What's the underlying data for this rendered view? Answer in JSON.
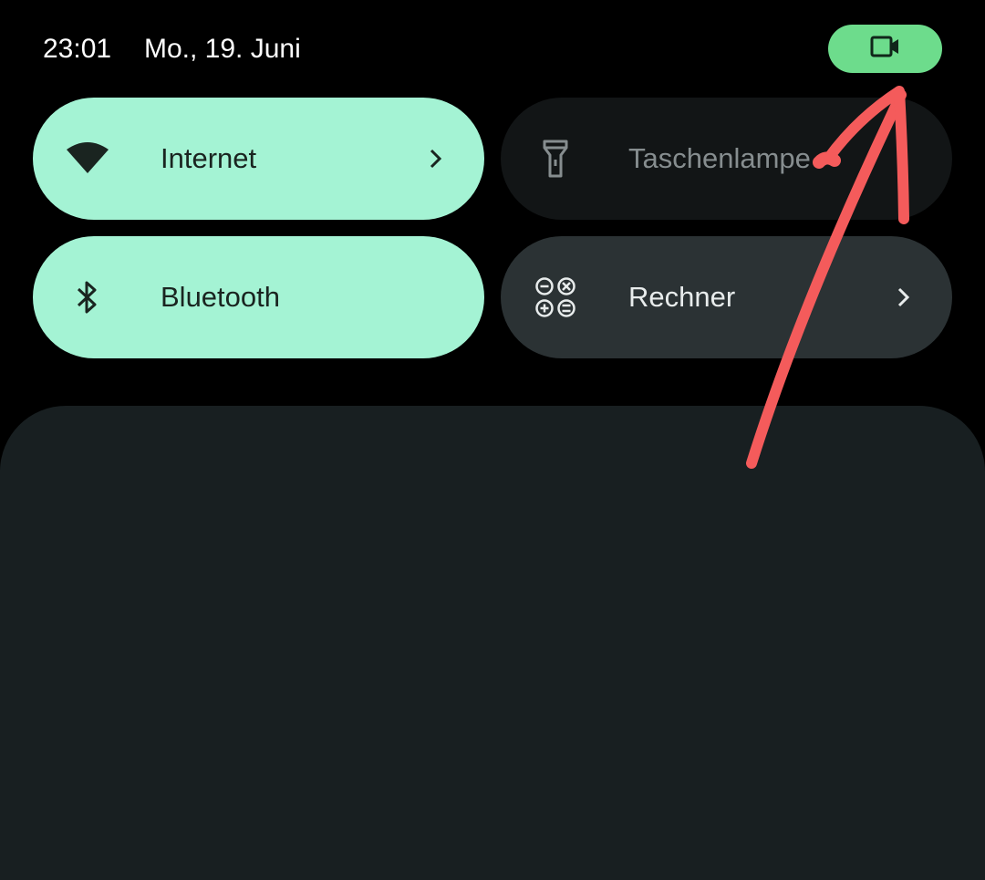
{
  "status_bar": {
    "time": "23:01",
    "date": "Mo., 19. Juni",
    "privacy_chip_icon": "video-camera-icon",
    "privacy_chip_color": "#6ddc8c"
  },
  "quick_settings": {
    "tiles": [
      {
        "label": "Internet",
        "icon": "wifi-icon",
        "state": "on",
        "has_chevron": true
      },
      {
        "label": "Taschenlampe",
        "icon": "flashlight-icon",
        "state": "off",
        "has_chevron": false
      },
      {
        "label": "Bluetooth",
        "icon": "bluetooth-icon",
        "state": "on",
        "has_chevron": false
      },
      {
        "label": "Rechner",
        "icon": "calculator-icon",
        "state": "shortcut",
        "has_chevron": true
      }
    ]
  },
  "colors": {
    "active_tile": "#a4f3d4",
    "inactive_tile": "#121516",
    "shortcut_tile": "#2b3234",
    "panel": "#181f21",
    "annotation": "#f45b5b"
  },
  "annotation": {
    "type": "hand-drawn-arrow",
    "points_to": "privacy-chip"
  }
}
